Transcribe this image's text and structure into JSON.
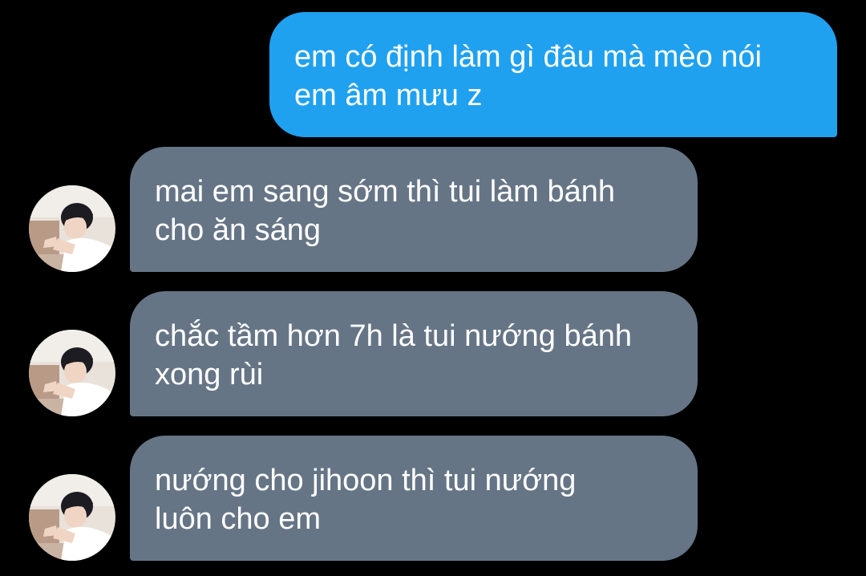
{
  "conversation": {
    "messages": [
      {
        "sender": "me",
        "text": "em có định làm gì đâu mà mèo nói\nem âm mưu z"
      },
      {
        "sender": "other",
        "text": "mai em sang sớm thì tui làm bánh\ncho ăn sáng"
      },
      {
        "sender": "other",
        "text": "chắc tầm hơn 7h là tui nướng bánh\nxong rùi"
      },
      {
        "sender": "other",
        "text": "nướng cho jihoon thì tui nướng\nluôn cho em"
      }
    ]
  },
  "colors": {
    "background": "#000000",
    "sent_bubble": "#1fa1f0",
    "received_bubble": "#667585",
    "text": "#ffffff"
  },
  "icons": {
    "avatar": "contact-profile-photo"
  }
}
